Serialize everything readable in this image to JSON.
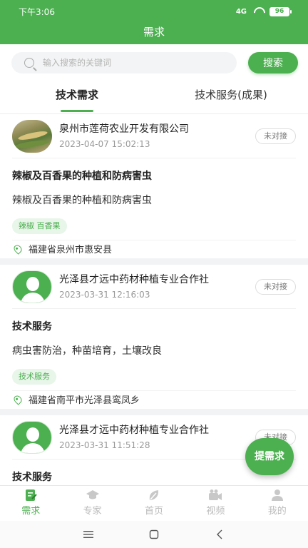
{
  "status_bar": {
    "time": "下午3:06",
    "signal": "4G",
    "battery": "96"
  },
  "header": {
    "title": "需求"
  },
  "search": {
    "placeholder": "输入搜索的关键词",
    "button_label": "搜索"
  },
  "tabs": [
    {
      "label": "技术需求",
      "active": true
    },
    {
      "label": "技术服务(成果)",
      "active": false
    }
  ],
  "cards": [
    {
      "company": "泉州市莲荷农业开发有限公司",
      "date": "2023-04-07 15:02:13",
      "status": "未对接",
      "title": "辣椒及百香果的种植和防病害虫",
      "description": "辣椒及百香果的种植和防病害虫",
      "tag": "辣椒 百香果",
      "location": "福建省泉州市惠安县"
    },
    {
      "company": "光泽县才远中药材种植专业合作社",
      "date": "2023-03-31 12:16:03",
      "status": "未对接",
      "title": "技术服务",
      "description": "病虫害防治，种苗培育，土壤改良",
      "tag": "技术服务",
      "location": "福建省南平市光泽县鸾凤乡"
    },
    {
      "company": "光泽县才远中药材种植专业合作社",
      "date": "2023-03-31 11:51:28",
      "status": "未对接",
      "title": "技术服务"
    }
  ],
  "fab": {
    "label": "提需求"
  },
  "tab_bar": [
    {
      "label": "需求",
      "icon": "edit-doc-icon",
      "active": true
    },
    {
      "label": "专家",
      "icon": "graduation-cap-icon",
      "active": false
    },
    {
      "label": "首页",
      "icon": "leaf-icon",
      "active": false
    },
    {
      "label": "视频",
      "icon": "video-camera-icon",
      "active": false
    },
    {
      "label": "我的",
      "icon": "person-icon",
      "active": false
    }
  ],
  "colors": {
    "primary": "#4caf50",
    "tag_bg": "#e8f5e9",
    "inactive": "#bbbbbb"
  }
}
